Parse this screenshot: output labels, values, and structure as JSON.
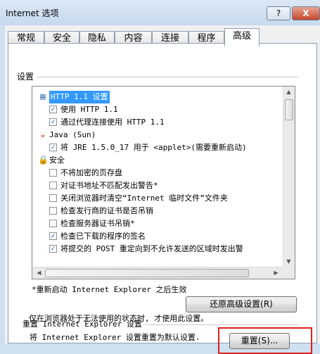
{
  "window": {
    "title": "Internet 选项",
    "help_label": "?",
    "close_label": "X"
  },
  "tabs": [
    {
      "label": "常规",
      "active": false
    },
    {
      "label": "安全",
      "active": false
    },
    {
      "label": "隐私",
      "active": false
    },
    {
      "label": "内容",
      "active": false
    },
    {
      "label": "连接",
      "active": false
    },
    {
      "label": "程序",
      "active": false
    },
    {
      "label": "高级",
      "active": true
    }
  ],
  "settings": {
    "group_label": "设置",
    "items": [
      {
        "type": "category",
        "icon": "http-icon",
        "label": "HTTP 1.1 设置",
        "selected": true
      },
      {
        "type": "checkbox",
        "checked": true,
        "label": "使用 HTTP 1.1"
      },
      {
        "type": "checkbox",
        "checked": true,
        "label": "通过代理连接使用 HTTP 1.1"
      },
      {
        "type": "category",
        "icon": "java-icon",
        "label": "Java (Sun)"
      },
      {
        "type": "checkbox",
        "checked": true,
        "label": "将 JRE 1.5.0_17 用于 <applet>(需要重新启动)"
      },
      {
        "type": "category",
        "icon": "lock-icon",
        "label": "安全"
      },
      {
        "type": "checkbox",
        "checked": false,
        "label": "不将加密的页存盘"
      },
      {
        "type": "checkbox",
        "checked": false,
        "label": "对证书地址不匹配发出警告*"
      },
      {
        "type": "checkbox",
        "checked": false,
        "label": "关闭浏览器时清空“Internet 临时文件”文件夹"
      },
      {
        "type": "checkbox",
        "checked": false,
        "label": "检查发行商的证书是否吊销"
      },
      {
        "type": "checkbox",
        "checked": false,
        "label": "检查服务器证书吊销*"
      },
      {
        "type": "checkbox",
        "checked": true,
        "label": "检查已下载的程序的签名"
      },
      {
        "type": "checkbox",
        "checked": true,
        "label": "将提交的 POST 重定向到不允许发送的区域时发出警"
      }
    ],
    "restart_note": "*重新启动 Internet Explorer 之后生效",
    "restore_button": "还原高级设置(R)"
  },
  "reset": {
    "group_label": "重置 Internet Explorer 设置",
    "description": "将 Internet Explorer 设置重置为默认设置.",
    "reset_button": "重置(S)...",
    "note": "仅在浏览器处于无法使用的状态时, 才使用此设置。"
  },
  "colors": {
    "highlight": "#e0201b",
    "selection": "#3399ff",
    "accent": "#1b4fa0"
  }
}
